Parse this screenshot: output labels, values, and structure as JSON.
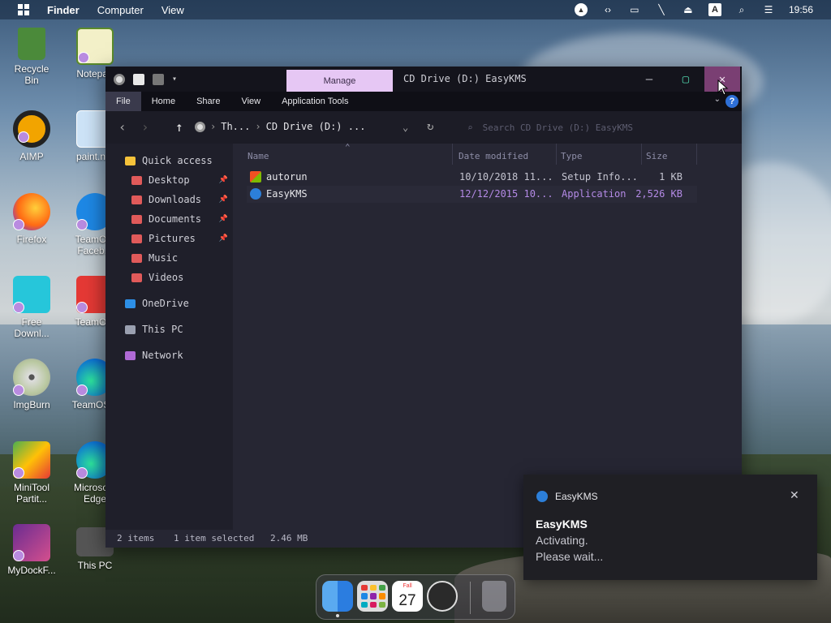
{
  "menubar": {
    "items": [
      "Finder",
      "Computer",
      "View"
    ],
    "clock": "19:56",
    "input_badge": "A"
  },
  "desktop_icons": [
    {
      "label": "Recycle Bin"
    },
    {
      "label": "Notepad"
    },
    {
      "label": "AIMP"
    },
    {
      "label": "paint.n..."
    },
    {
      "label": "Firefox"
    },
    {
      "label": "TeamO... Faceb..."
    },
    {
      "label": "Free Downl..."
    },
    {
      "label": "TeamO..."
    },
    {
      "label": "ImgBurn"
    },
    {
      "label": "TeamOS..."
    },
    {
      "label": "MiniTool Partit..."
    },
    {
      "label": "Microso... Edge"
    },
    {
      "label": "MyDockF..."
    },
    {
      "label": "This PC"
    }
  ],
  "window": {
    "manage_tab": "Manage",
    "title": "CD Drive (D:) EasyKMS",
    "ribbon_tabs": [
      "File",
      "Home",
      "Share",
      "View",
      "Application Tools"
    ],
    "help": "?",
    "breadcrumb": [
      "Th...",
      "CD Drive (D:) ..."
    ],
    "search_placeholder": "Search CD Drive (D:) EasyKMS",
    "nav": {
      "quick_access": "Quick access",
      "items": [
        "Desktop",
        "Downloads",
        "Documents",
        "Pictures",
        "Music",
        "Videos"
      ],
      "onedrive": "OneDrive",
      "this_pc": "This PC",
      "network": "Network"
    },
    "columns": [
      "Name",
      "Date modified",
      "Type",
      "Size"
    ],
    "files": [
      {
        "name": "autorun",
        "date": "10/10/2018 11...",
        "type": "Setup Info...",
        "size": "1 KB"
      },
      {
        "name": "EasyKMS",
        "date": "12/12/2015 10...",
        "type": "Application",
        "size": "2,526 KB"
      }
    ],
    "status": {
      "items": "2 items",
      "selected": "1 item selected",
      "size": "2.46 MB"
    }
  },
  "toast": {
    "app_name": "EasyKMS",
    "title": "EasyKMS",
    "line1": "Activating.",
    "line2": "Please wait..."
  },
  "dock": {
    "calendar_month": "Fall",
    "calendar_day": "27"
  },
  "colors": {
    "manage_tab": "#e6c7f4",
    "close_button": "#7a3f73",
    "window_bg": "#262633",
    "accent_purple": "#b48ae6"
  }
}
